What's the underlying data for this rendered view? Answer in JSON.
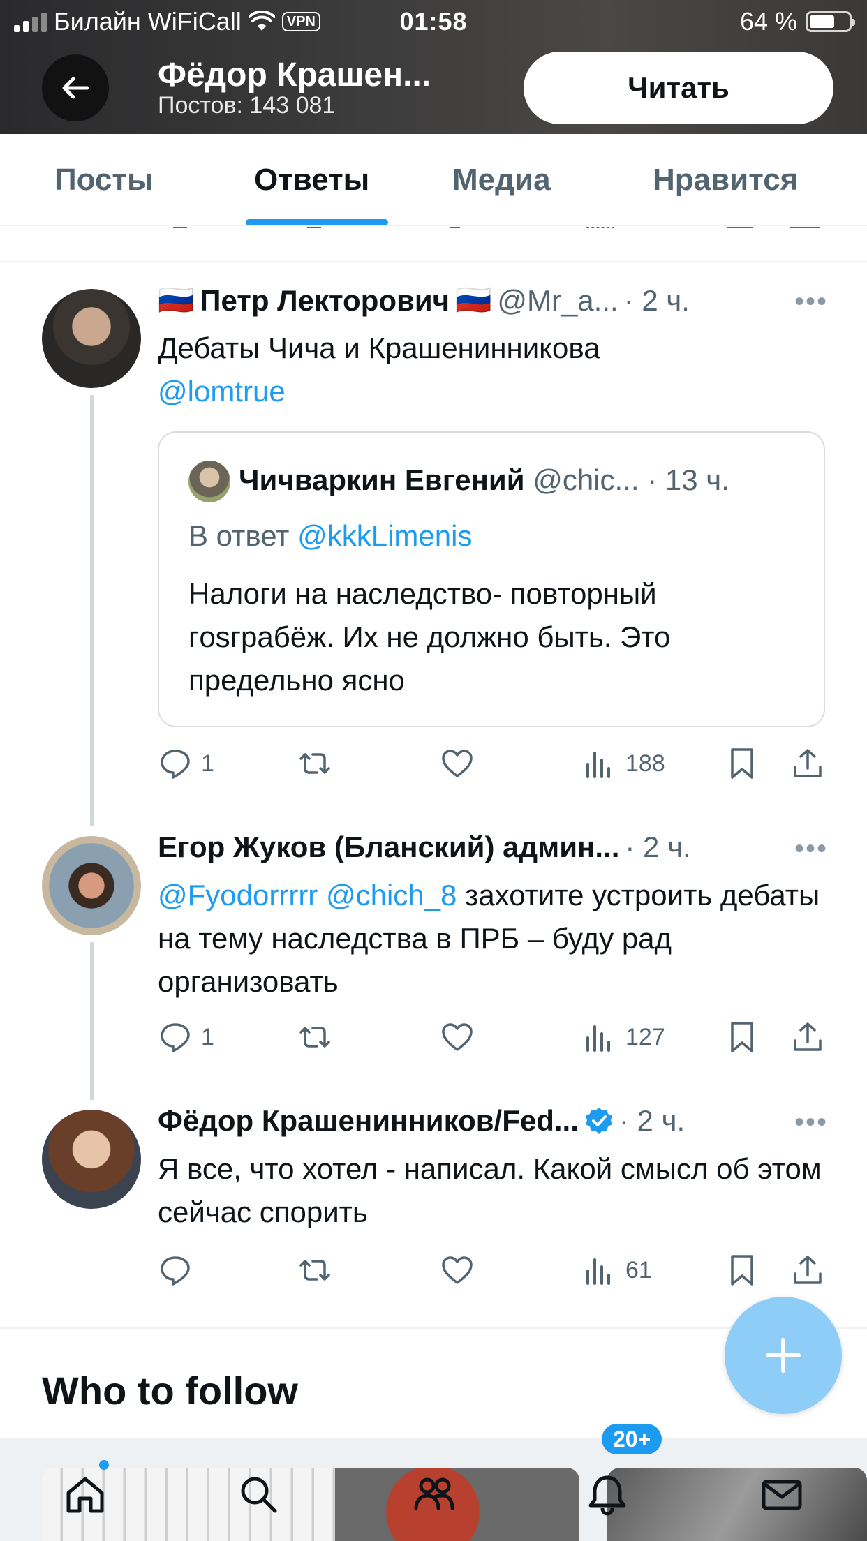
{
  "status_bar": {
    "carrier": "Билайн WiFiCall",
    "vpn": "VPN",
    "time": "01:58",
    "battery": "64 %"
  },
  "header": {
    "profile_name": "Фёдор Крашен...",
    "post_count": "Постов: 143 081",
    "follow_label": "Читать"
  },
  "tabs": [
    {
      "label": "Посты"
    },
    {
      "label": "Ответы"
    },
    {
      "label": "Медиа"
    },
    {
      "label": "Нравится"
    }
  ],
  "posts": [
    {
      "name": "Петр Лекторович",
      "flag": "🇷🇺",
      "handle": "@Mr_a...",
      "time": "· 2 ч.",
      "text": "Дебаты Чича и Крашенинникова",
      "mention": "@lomtrue",
      "quote": {
        "name": "Чичваркин Евгений",
        "handle": "@chic...",
        "time": "· 13 ч.",
        "reply_prefix": "В ответ",
        "reply_to": "@kkkLimenis",
        "text": "Налоги на наследство- повторный гosграбёж. Их не должно быть.  Это предельно ясно"
      },
      "replies": "1",
      "views": "188"
    },
    {
      "name": "Егор Жуков (Бланский) админ...",
      "time": "· 2 ч.",
      "mention1": "@Fyodorrrrr",
      "mention2": "@chich_8",
      "text": " захотите устроить дебаты на тему наследства в ПРБ – буду рад организовать",
      "replies": "1",
      "views": "127"
    },
    {
      "name": "Фёдор Крашенинников/Fed...",
      "time": "· 2 ч.",
      "text": "Я все, что хотел - написал. Какой смысл об этом сейчас спорить",
      "replies": "",
      "views": "61"
    }
  ],
  "who_to_follow": "Who to follow",
  "notifications_badge": "20+",
  "colors": {
    "accent": "#1d9bf0",
    "text": "#0f1419",
    "secondary": "#536471"
  }
}
